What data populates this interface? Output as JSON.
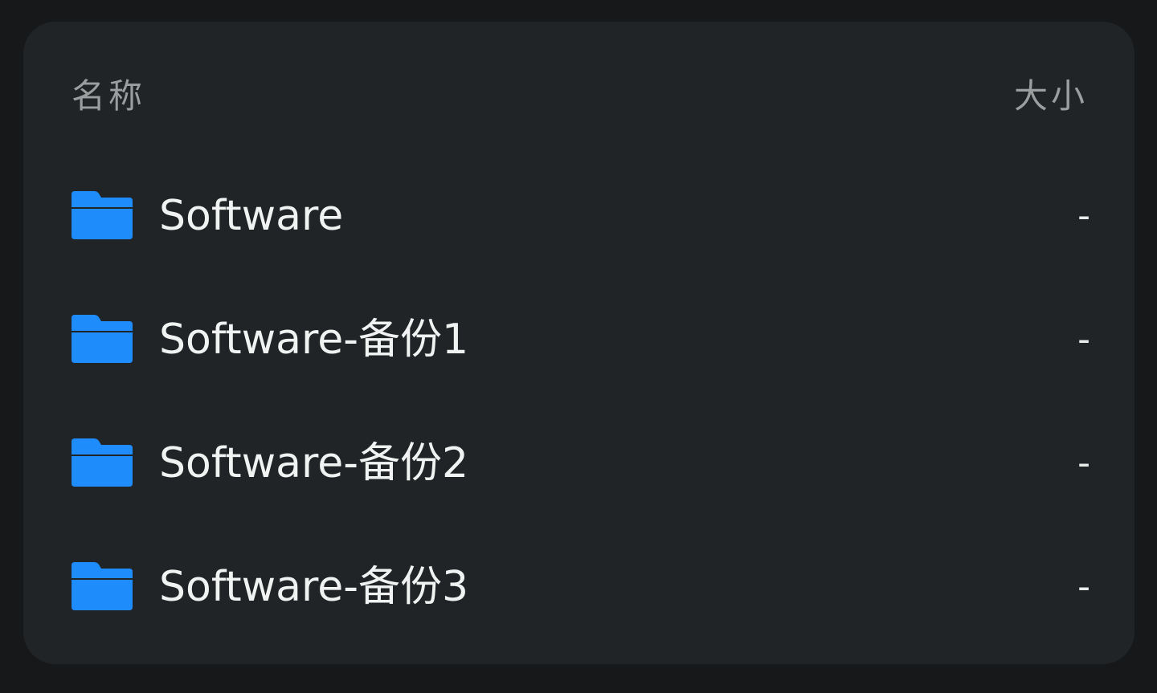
{
  "header": {
    "name_label": "名称",
    "size_label": "大小"
  },
  "files": [
    {
      "name": "Software",
      "size": "-",
      "icon": "folder-icon",
      "icon_color": "#1e8cfb"
    },
    {
      "name": "Software-备份1",
      "size": "-",
      "icon": "folder-icon",
      "icon_color": "#1e8cfb"
    },
    {
      "name": "Software-备份2",
      "size": "-",
      "icon": "folder-icon",
      "icon_color": "#1e8cfb"
    },
    {
      "name": "Software-备份3",
      "size": "-",
      "icon": "folder-icon",
      "icon_color": "#1e8cfb"
    }
  ],
  "colors": {
    "background": "#161819",
    "panel": "#212426",
    "header_text": "#9b9e9f",
    "row_text": "#f1f3f3",
    "accent": "#1e8cfb"
  }
}
